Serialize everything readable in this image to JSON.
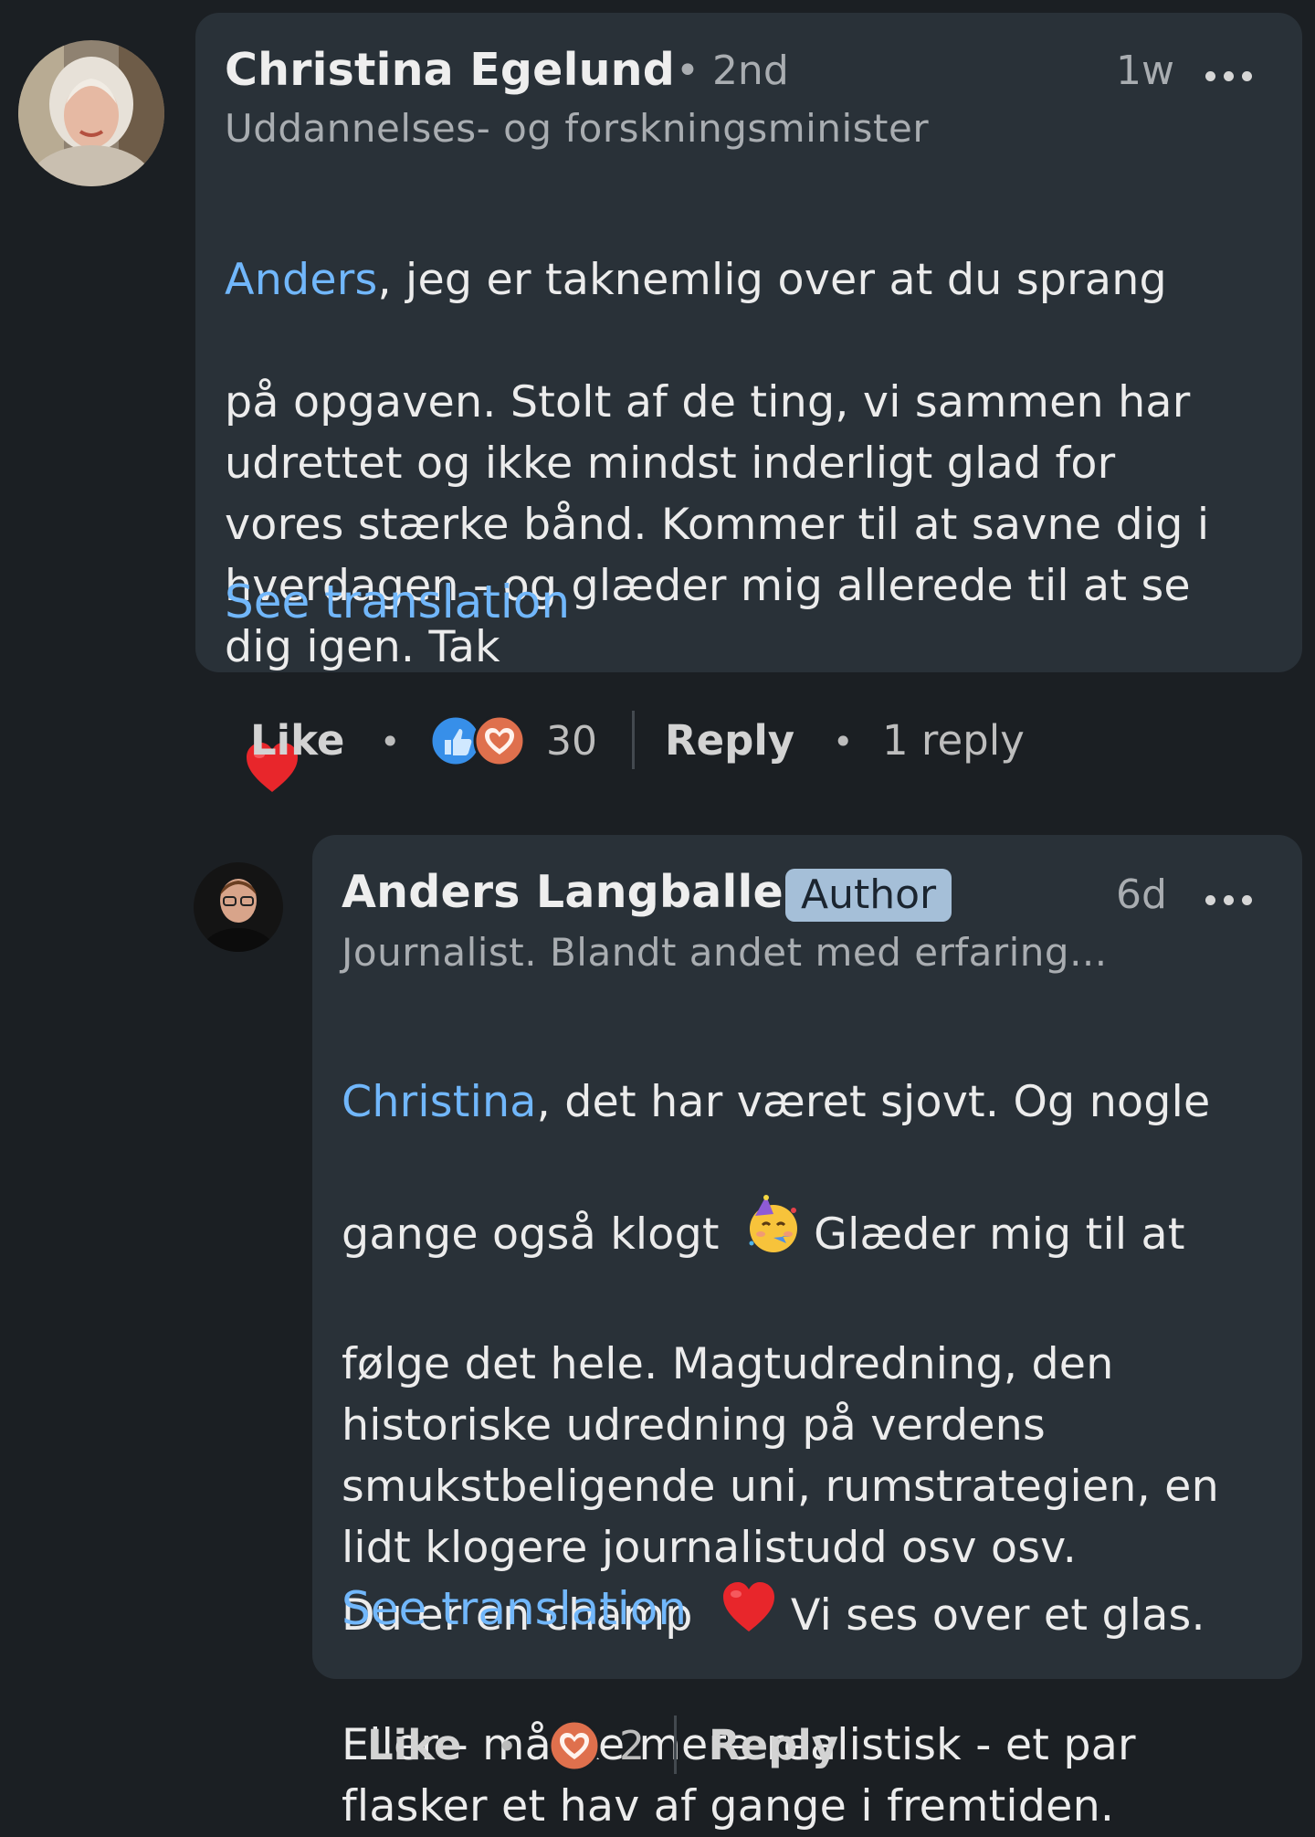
{
  "comments": [
    {
      "author": "Christina Egelund",
      "degree": "• 2nd",
      "time": "1w",
      "headline": "Uddannelses- og forskningsminister",
      "mention": "Anders",
      "text_line1_rest": ",  jeg er taknemlig over at du sprang",
      "text_rest": "på opgaven. Stolt af de ting, vi sammen har\nudrettet og ikke mindst inderligt glad for\nvores stærke bånd. Kommer til at savne dig i\nhverdagen - og glæder mig allerede til at se\ndig igen. Tak",
      "see_translation": "See translation",
      "like_label": "Like",
      "reaction_count": "30",
      "reply_label": "Reply",
      "replies_label": "1 reply",
      "reactions": [
        "like-icon",
        "love-icon"
      ]
    },
    {
      "author": "Anders Langballe",
      "badge": "Author",
      "time": "6d",
      "headline": "Journalist. Blandt andet med erfaring...",
      "mention": "Christina",
      "text_line1_rest": ", det har været sjovt. Og nogle",
      "text_line2": "gange også klogt",
      "text_line2_after": "Glæder mig til at",
      "text_mid": "følge det hele. Magtudredning, den\nhistoriske udredning på verdens\nsmukstbeligende uni, rumstrategien, en\nlidt klogere journalistudd osv osv.",
      "text_line7": "Du er en champ",
      "text_line7_after": "Vi ses over et glas.",
      "text_end": "Eller - måske mere realistisk - et par\nflasker et hav af gange i fremtiden.",
      "see_translation": "See translation",
      "like_label": "Like",
      "reaction_count": "2",
      "reply_label": "Reply",
      "reactions": [
        "love-icon"
      ]
    }
  ],
  "colors": {
    "background": "#1b1f23",
    "bubble": "#293138",
    "link": "#71b7fb",
    "badge": "#a5bfd8"
  }
}
